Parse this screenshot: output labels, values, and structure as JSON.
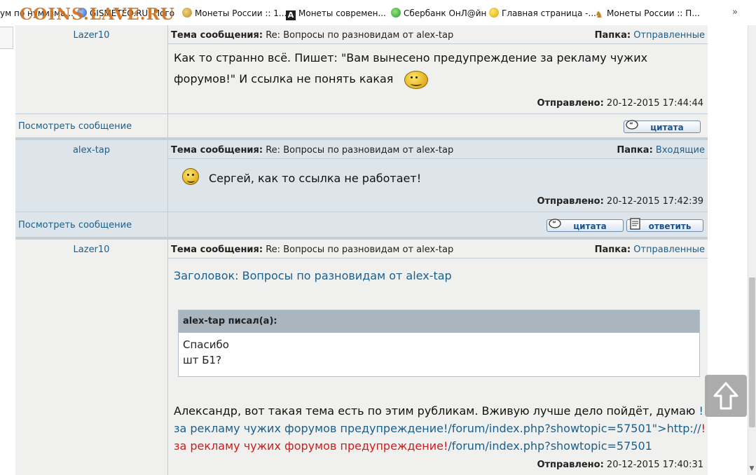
{
  "bookmarks": {
    "items": [
      {
        "label": "ум по нумизма...",
        "icon": "coin-icon"
      },
      {
        "label": "GISMETEO.RU: Пого",
        "icon": "globe-icon"
      },
      {
        "label": "Монеты России :: 1...",
        "icon": "coin-icon"
      },
      {
        "label": "Монеты современ...",
        "icon": "a-icon"
      },
      {
        "label": "Сбербанк ОнЛ@йн",
        "icon": "sber-icon"
      },
      {
        "label": "Главная страница -...",
        "icon": "smile-icon"
      },
      {
        "label": "Монеты России :: П...",
        "icon": "man-icon"
      }
    ],
    "overflow": "»",
    "watermark": "COINS.LAVE.RU"
  },
  "labels": {
    "topic": "Тема сообщения:",
    "folder": "Папка:",
    "sent": "Отправлено:",
    "view": "Посмотреть сообщение",
    "quote_btn": "цитата",
    "reply_btn": "ответить"
  },
  "messages": [
    {
      "author": "Lazer10",
      "topic": "Re: Вопросы по разновидам от alex-tap",
      "folder": "Отправленные",
      "text": "Как то странно всё. Пишет: \"Вам вынесено предупреждение за рекламу чужих форумов!\" И ссылка не понять какая",
      "sent": "20-12-2015 17:44:44"
    },
    {
      "author": "alex-tap",
      "topic": "Re: Вопросы по разновидам от alex-tap",
      "folder": "Входящие",
      "text": "Сергей, как то ссылка не работает!",
      "sent": "20-12-2015 17:42:39"
    },
    {
      "author": "Lazer10",
      "topic": "Re: Вопросы по разновидам от alex-tap",
      "folder": "Отправленные",
      "subject": "Заголовок: Вопросы по разновидам от alex-tap",
      "quote_author": "alex-tap писал(а):",
      "quote_line1": "Спасибо",
      "quote_line2": "шт Б1?",
      "text_plain": "Александр, вот такая тема есть по этим рубликам. Вживую лучше дело пойдёт, думаю ",
      "link_blue": "!за рекламу чужих форумов предупреждение!/forum/index.php?showtopic=57501\">http://",
      "link_red_a": "!за рекламу чужих форумов предупреждение!",
      "link_red_b": "/forum/index.php?showtopic=57501",
      "sent": "20-12-2015 17:40:31"
    }
  ],
  "colors": {
    "link": "#1b5f8c",
    "warning": "#d41a1a",
    "row_alt": "#dde4ea"
  }
}
